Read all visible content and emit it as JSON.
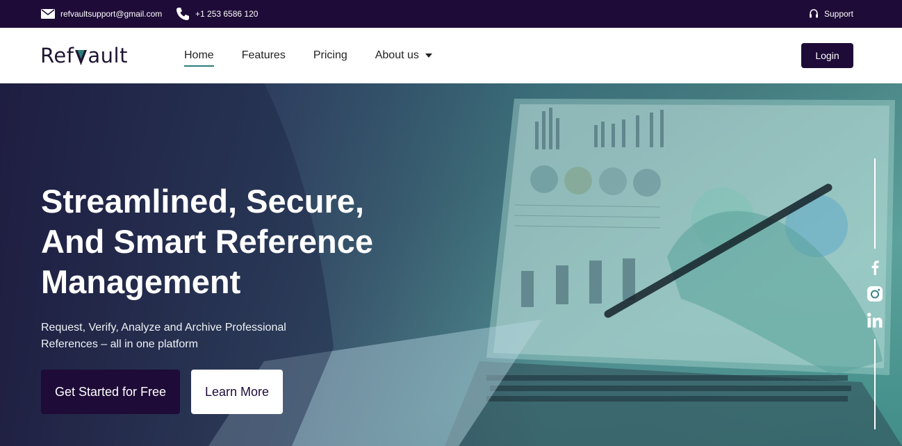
{
  "topbar": {
    "email": "refvaultsupport@gmail.com",
    "phone": "+1 253 6586 120",
    "support": "Support",
    "icons": [
      "mail-icon",
      "phone-icon",
      "headset-icon"
    ]
  },
  "navbar": {
    "logo": {
      "text_prefix": "Ref",
      "text_suffix": "ault"
    },
    "links": [
      {
        "label": "Home",
        "active": true
      },
      {
        "label": "Features"
      },
      {
        "label": "Pricing"
      },
      {
        "label": "About us",
        "dropdown": true
      }
    ],
    "login_label": "Login"
  },
  "hero": {
    "title_lines": [
      "Streamlined, Secure,",
      "And Smart Reference",
      "Management"
    ],
    "subtitle_lines": [
      "Request, Verify, Analyze and Archive Professional",
      "References – all in one platform"
    ],
    "primary_button": "Get Started for Free",
    "secondary_button": "Learn More"
  },
  "social": {
    "icons": [
      "facebook-icon",
      "instagram-icon",
      "linkedin-icon"
    ]
  },
  "colors": {
    "brand_dark": "#1e0b37",
    "accent_teal": "#2a7d7a",
    "white": "#ffffff"
  }
}
